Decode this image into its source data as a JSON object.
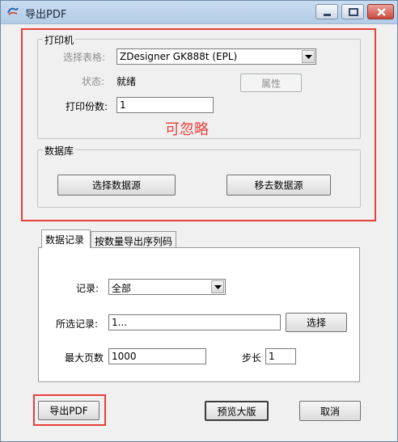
{
  "window": {
    "title": "导出PDF"
  },
  "printer": {
    "group_label": "打印机",
    "select_label": "选择表格:",
    "select_value": "ZDesigner GK888t (EPL)",
    "status_label": "状态:",
    "status_value": "就绪",
    "properties_button": "属性",
    "copies_label": "打印份数:",
    "copies_value": "1"
  },
  "annotation": {
    "note": "可忽略"
  },
  "database": {
    "group_label": "数据库",
    "select_source_button": "选择数据源",
    "remove_source_button": "移去数据源"
  },
  "tabs": [
    {
      "label": "数据记录"
    },
    {
      "label": "按数量导出序列码"
    }
  ],
  "records": {
    "record_label": "记录:",
    "record_value": "全部",
    "selected_label": "所选记录:",
    "selected_value": "1...",
    "choose_button": "选择",
    "max_pages_label": "最大页数",
    "max_pages_value": "1000",
    "step_label": "步长",
    "step_value": "1"
  },
  "footer": {
    "export_button": "导出PDF",
    "preview_button": "预览大版",
    "cancel_button": "取消"
  },
  "colors": {
    "annotation_red": "#e8403a",
    "titlebar": "#b3cbe6"
  }
}
